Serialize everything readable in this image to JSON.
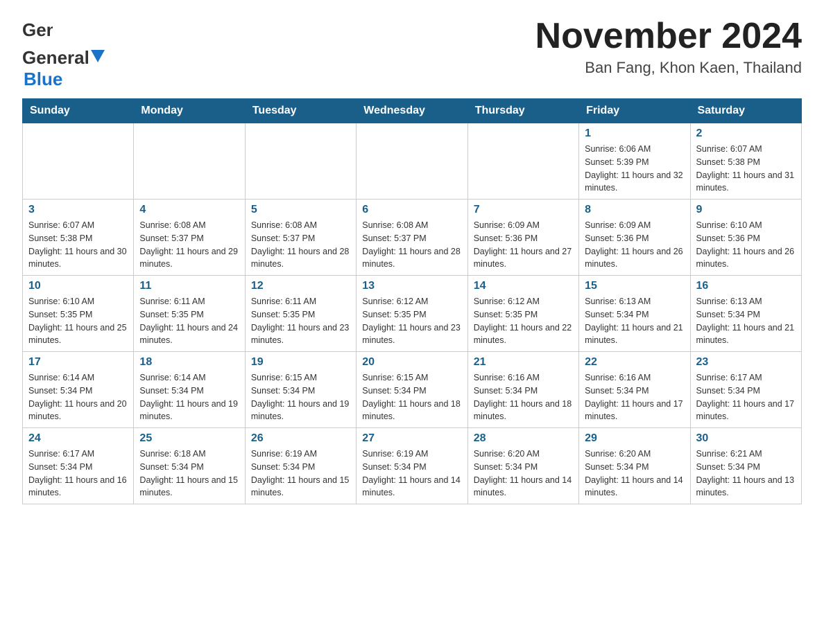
{
  "header": {
    "logo_general": "General",
    "logo_blue": "Blue",
    "title": "November 2024",
    "subtitle": "Ban Fang, Khon Kaen, Thailand"
  },
  "days_of_week": [
    "Sunday",
    "Monday",
    "Tuesday",
    "Wednesday",
    "Thursday",
    "Friday",
    "Saturday"
  ],
  "weeks": [
    [
      {
        "day": "",
        "info": ""
      },
      {
        "day": "",
        "info": ""
      },
      {
        "day": "",
        "info": ""
      },
      {
        "day": "",
        "info": ""
      },
      {
        "day": "",
        "info": ""
      },
      {
        "day": "1",
        "info": "Sunrise: 6:06 AM\nSunset: 5:39 PM\nDaylight: 11 hours and 32 minutes."
      },
      {
        "day": "2",
        "info": "Sunrise: 6:07 AM\nSunset: 5:38 PM\nDaylight: 11 hours and 31 minutes."
      }
    ],
    [
      {
        "day": "3",
        "info": "Sunrise: 6:07 AM\nSunset: 5:38 PM\nDaylight: 11 hours and 30 minutes."
      },
      {
        "day": "4",
        "info": "Sunrise: 6:08 AM\nSunset: 5:37 PM\nDaylight: 11 hours and 29 minutes."
      },
      {
        "day": "5",
        "info": "Sunrise: 6:08 AM\nSunset: 5:37 PM\nDaylight: 11 hours and 28 minutes."
      },
      {
        "day": "6",
        "info": "Sunrise: 6:08 AM\nSunset: 5:37 PM\nDaylight: 11 hours and 28 minutes."
      },
      {
        "day": "7",
        "info": "Sunrise: 6:09 AM\nSunset: 5:36 PM\nDaylight: 11 hours and 27 minutes."
      },
      {
        "day": "8",
        "info": "Sunrise: 6:09 AM\nSunset: 5:36 PM\nDaylight: 11 hours and 26 minutes."
      },
      {
        "day": "9",
        "info": "Sunrise: 6:10 AM\nSunset: 5:36 PM\nDaylight: 11 hours and 26 minutes."
      }
    ],
    [
      {
        "day": "10",
        "info": "Sunrise: 6:10 AM\nSunset: 5:35 PM\nDaylight: 11 hours and 25 minutes."
      },
      {
        "day": "11",
        "info": "Sunrise: 6:11 AM\nSunset: 5:35 PM\nDaylight: 11 hours and 24 minutes."
      },
      {
        "day": "12",
        "info": "Sunrise: 6:11 AM\nSunset: 5:35 PM\nDaylight: 11 hours and 23 minutes."
      },
      {
        "day": "13",
        "info": "Sunrise: 6:12 AM\nSunset: 5:35 PM\nDaylight: 11 hours and 23 minutes."
      },
      {
        "day": "14",
        "info": "Sunrise: 6:12 AM\nSunset: 5:35 PM\nDaylight: 11 hours and 22 minutes."
      },
      {
        "day": "15",
        "info": "Sunrise: 6:13 AM\nSunset: 5:34 PM\nDaylight: 11 hours and 21 minutes."
      },
      {
        "day": "16",
        "info": "Sunrise: 6:13 AM\nSunset: 5:34 PM\nDaylight: 11 hours and 21 minutes."
      }
    ],
    [
      {
        "day": "17",
        "info": "Sunrise: 6:14 AM\nSunset: 5:34 PM\nDaylight: 11 hours and 20 minutes."
      },
      {
        "day": "18",
        "info": "Sunrise: 6:14 AM\nSunset: 5:34 PM\nDaylight: 11 hours and 19 minutes."
      },
      {
        "day": "19",
        "info": "Sunrise: 6:15 AM\nSunset: 5:34 PM\nDaylight: 11 hours and 19 minutes."
      },
      {
        "day": "20",
        "info": "Sunrise: 6:15 AM\nSunset: 5:34 PM\nDaylight: 11 hours and 18 minutes."
      },
      {
        "day": "21",
        "info": "Sunrise: 6:16 AM\nSunset: 5:34 PM\nDaylight: 11 hours and 18 minutes."
      },
      {
        "day": "22",
        "info": "Sunrise: 6:16 AM\nSunset: 5:34 PM\nDaylight: 11 hours and 17 minutes."
      },
      {
        "day": "23",
        "info": "Sunrise: 6:17 AM\nSunset: 5:34 PM\nDaylight: 11 hours and 17 minutes."
      }
    ],
    [
      {
        "day": "24",
        "info": "Sunrise: 6:17 AM\nSunset: 5:34 PM\nDaylight: 11 hours and 16 minutes."
      },
      {
        "day": "25",
        "info": "Sunrise: 6:18 AM\nSunset: 5:34 PM\nDaylight: 11 hours and 15 minutes."
      },
      {
        "day": "26",
        "info": "Sunrise: 6:19 AM\nSunset: 5:34 PM\nDaylight: 11 hours and 15 minutes."
      },
      {
        "day": "27",
        "info": "Sunrise: 6:19 AM\nSunset: 5:34 PM\nDaylight: 11 hours and 14 minutes."
      },
      {
        "day": "28",
        "info": "Sunrise: 6:20 AM\nSunset: 5:34 PM\nDaylight: 11 hours and 14 minutes."
      },
      {
        "day": "29",
        "info": "Sunrise: 6:20 AM\nSunset: 5:34 PM\nDaylight: 11 hours and 14 minutes."
      },
      {
        "day": "30",
        "info": "Sunrise: 6:21 AM\nSunset: 5:34 PM\nDaylight: 11 hours and 13 minutes."
      }
    ]
  ]
}
